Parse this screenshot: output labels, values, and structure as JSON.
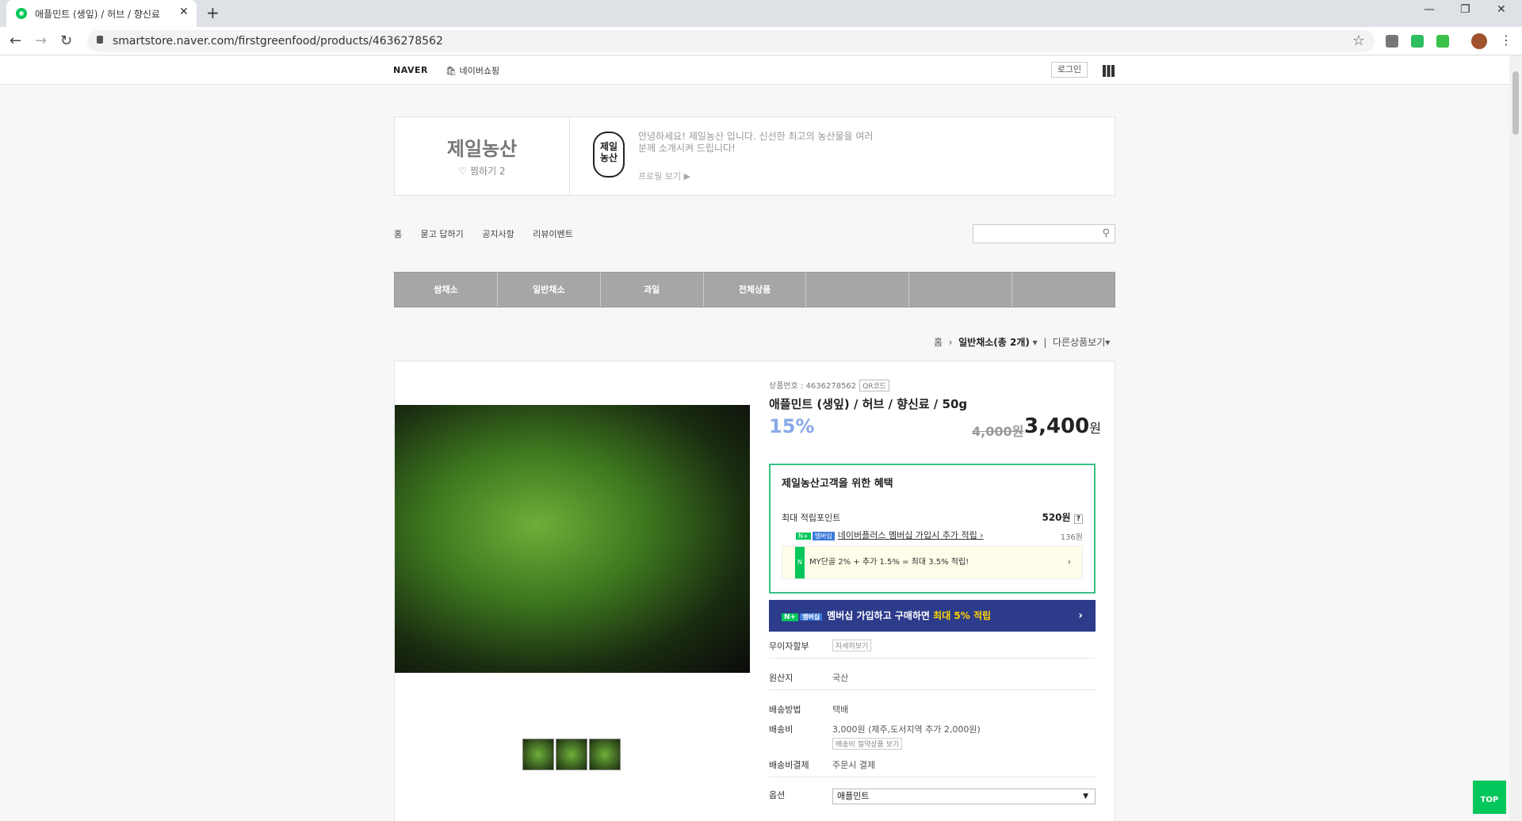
{
  "browser": {
    "tab_title": "애플민트 (생잎) / 허브 / 향신료",
    "url": "smartstore.naver.com/firstgreenfood/products/4636278562"
  },
  "gnb": {
    "naver": "NAVER",
    "shopping": "네이버쇼핑",
    "login": "로그인"
  },
  "store": {
    "name": "제일농산",
    "favorites": "찜하기 2",
    "logo_text": "제일농산",
    "intro": "안녕하세요! 제일농산 입니다. 신선한 최고의 농산물을 여러분께 소개시켜 드립니다!",
    "profile_link": "프로필 보기 ▶"
  },
  "store_nav": [
    "홈",
    "묻고 답하기",
    "공지사항",
    "리뷰이벤트"
  ],
  "categories": [
    "쌈채소",
    "일반채소",
    "과일",
    "전체상품",
    "",
    "",
    ""
  ],
  "breadcrumb": {
    "home": "홈",
    "current": "일반채소(총 2개)",
    "other": "다른상품보기"
  },
  "product": {
    "number_label": "상품번호 : 4636278562",
    "qr": "QR코드",
    "name": "애플민트 (생잎) / 허브 / 향신료 / 50g",
    "discount": "15%",
    "original_price": "4,000원",
    "price": "3,400",
    "price_unit": "원"
  },
  "benefit": {
    "title": "제일농산고객을 위한 혜택",
    "point_label": "최대 적립포인트",
    "point_value": "520원",
    "nplus_badge": "N+",
    "nplus_badge2": "멤버십",
    "nplus_text": "네이버플러스 멤버십 가입시 추가 적립",
    "nplus_value": "136원",
    "my_text": "MY단골 2% + 추가 1.5% = 최대 3.5% 적립!"
  },
  "banner": {
    "text": "멤버십 가입하고 구매하면",
    "highlight": "최대 5% 적립"
  },
  "rows": {
    "installment_label": "무이자할부",
    "installment_btn": "자세히보기",
    "origin_label": "원산지",
    "origin_value": "국산",
    "ship_method_label": "배송방법",
    "ship_method_value": "택배",
    "ship_fee_label": "배송비",
    "ship_fee_value": "3,000원 (제주,도서지역 추가 2,000원)",
    "ship_fee_btn": "배송비 절약상품 보기",
    "ship_pay_label": "배송비결제",
    "ship_pay_value": "주문시 결제",
    "option_label": "옵션",
    "option_value": "애플민트"
  },
  "top_button": "TOP"
}
